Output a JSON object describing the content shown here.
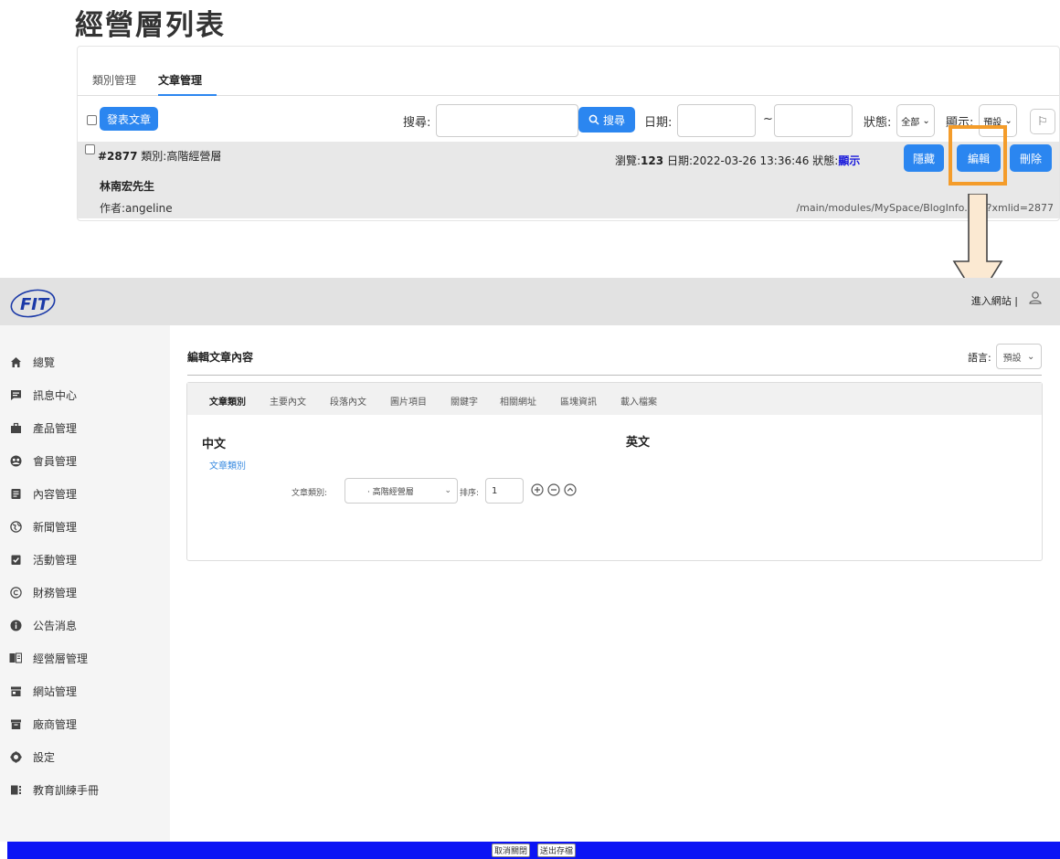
{
  "list_view": {
    "title": "經營層列表",
    "tabs": [
      "類別管理",
      "文章管理"
    ],
    "post_button": "發表文章",
    "search_label": "搜尋:",
    "search_button": "搜尋",
    "date_label": "日期:",
    "date_sep": "~",
    "status_label": "狀態:",
    "status_value": "全部",
    "display_label": "顯示:",
    "display_value": "預設",
    "row": {
      "id": "#2877",
      "category": "類別:高階經營層",
      "views_label": "瀏覽:",
      "views": "123",
      "date": "日期:2022-03-26 13:36:46",
      "status_label": "狀態:",
      "status": "顯示",
      "hide_button": "隱藏",
      "edit_button": "編輯",
      "delete_button": "刪除",
      "name": "林南宏先生",
      "author": "作者:angeline",
      "url": "/main/modules/MySpace/BlogInfo.php?xmlid=2877"
    },
    "accent_color": "#2b86f0",
    "highlight_color": "#f49c2a"
  },
  "header": {
    "logo_text": "FIT",
    "site_link": "進入網站",
    "separator": "|"
  },
  "sidebar": {
    "items": [
      {
        "label": "總覽",
        "icon": "home-icon"
      },
      {
        "label": "訊息中心",
        "icon": "message-icon"
      },
      {
        "label": "產品管理",
        "icon": "briefcase-icon"
      },
      {
        "label": "會員管理",
        "icon": "members-icon"
      },
      {
        "label": "內容管理",
        "icon": "document-icon"
      },
      {
        "label": "新聞管理",
        "icon": "globe-icon"
      },
      {
        "label": "活動管理",
        "icon": "checklist-icon"
      },
      {
        "label": "財務管理",
        "icon": "copyright-icon"
      },
      {
        "label": "公告消息",
        "icon": "info-icon"
      },
      {
        "label": "經營層管理",
        "icon": "book-icon"
      },
      {
        "label": "網站管理",
        "icon": "store-icon"
      },
      {
        "label": "廠商管理",
        "icon": "archive-icon"
      },
      {
        "label": "設定",
        "icon": "gear-icon"
      },
      {
        "label": "教育訓練手冊",
        "icon": "manual-icon"
      }
    ]
  },
  "editor": {
    "title": "編輯文章內容",
    "language_label": "語言:",
    "language_value": "預設",
    "tabs": [
      "文章類別",
      "主要內文",
      "段落內文",
      "圖片項目",
      "關鍵字",
      "相關網址",
      "區塊資訊",
      "載入檔案"
    ],
    "col_zh": "中文",
    "col_en": "英文",
    "category_link": "文章類別",
    "category_label": "文章類別:",
    "category_value": "· 高階經營層",
    "order_label": "排序:",
    "order_value": "1"
  },
  "footer": {
    "cancel": "取消關閉",
    "save": "送出存檔",
    "color": "#0b14f5"
  }
}
